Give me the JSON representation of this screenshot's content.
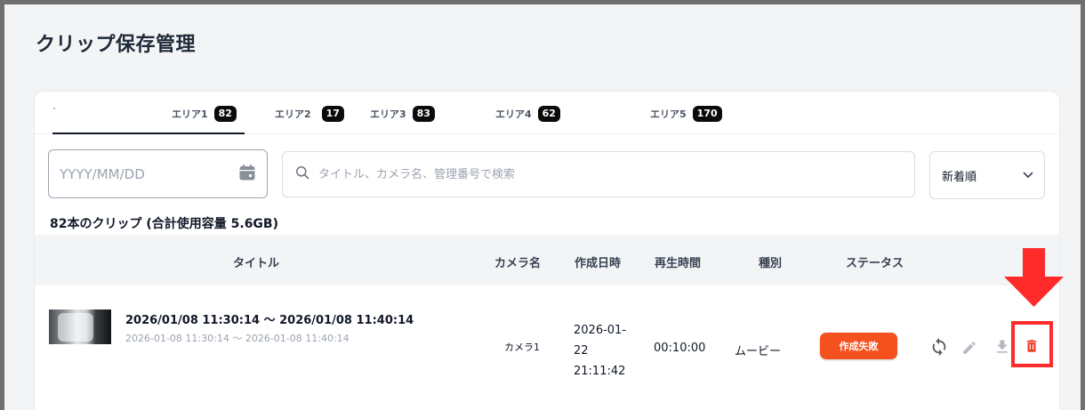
{
  "page": {
    "title": "クリップ保存管理"
  },
  "tabs": [
    {
      "label": "エリア1",
      "count": "82",
      "active": true
    },
    {
      "label": "エリア2",
      "count": "17"
    },
    {
      "label": "エリア3",
      "count": "83"
    },
    {
      "label": "エリア4",
      "count": "62"
    },
    {
      "label": "エリア5",
      "count": "170"
    }
  ],
  "filters": {
    "date_placeholder": "YYYY/MM/DD",
    "search_placeholder": "タイトル、カメラ名、管理番号で検索",
    "sort_value": "新着順"
  },
  "summary": "82本のクリップ (合計使用容量 5.6GB)",
  "table": {
    "columns": {
      "title": "タイトル",
      "camera": "カメラ名",
      "created": "作成日時",
      "duration": "再生時間",
      "type": "種別",
      "status": "ステータス"
    },
    "rows": [
      {
        "title": "2026/01/08 11:30:14 〜 2026/01/08 11:40:14",
        "subtitle": "2026-01-08 11:30:14 〜 2026-01-08 11:40:14",
        "camera": "カメラ1",
        "created_line1": "2026-01-",
        "created_line2": "22",
        "created_line3": "21:11:42",
        "duration": "00:10:00",
        "type": "ムービー",
        "status": "作成失敗"
      }
    ]
  },
  "icons": {
    "calendar": "calendar-icon",
    "search": "search-icon",
    "sort_chevron": "chevron-down-icon",
    "retry": "refresh-icon",
    "edit": "edit-icon",
    "download": "download-icon",
    "delete": "trash-icon",
    "annotation_arrow": "arrow-down-icon"
  },
  "colors": {
    "status_failed": "#f4511e",
    "delete_icon": "#ee3b22",
    "highlight": "#ff2b2b",
    "badge": "#0b0b0b"
  }
}
